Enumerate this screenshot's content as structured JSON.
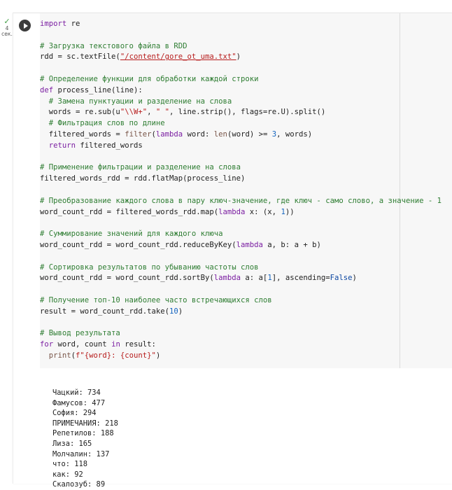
{
  "cell": {
    "status": {
      "check_symbol": "✓",
      "time_value": "4",
      "time_unit": "сек."
    },
    "code_lines": [
      [
        {
          "t": "import",
          "c": "kw"
        },
        {
          "t": " re",
          "c": ""
        }
      ],
      [],
      [
        {
          "t": "# Загрузка текстового файла в RDD",
          "c": "cm"
        }
      ],
      [
        {
          "t": "rdd = sc.textFile(",
          "c": ""
        },
        {
          "t": "\"/content/gore_ot_uma.txt\"",
          "c": "st url"
        },
        {
          "t": ")",
          "c": ""
        }
      ],
      [],
      [
        {
          "t": "# Определение функции для обработки каждой строки",
          "c": "cm"
        }
      ],
      [
        {
          "t": "def",
          "c": "kw"
        },
        {
          "t": " process_line(line):",
          "c": ""
        }
      ],
      [
        {
          "t": "  # Замена пунктуации и разделение на слова",
          "c": "cm"
        }
      ],
      [
        {
          "t": "  words = re.sub(u",
          "c": ""
        },
        {
          "t": "\"\\\\W+\"",
          "c": "st"
        },
        {
          "t": ", ",
          "c": ""
        },
        {
          "t": "\" \"",
          "c": "st"
        },
        {
          "t": ", line.strip(), flags=re.U).split()",
          "c": ""
        }
      ],
      [
        {
          "t": "  # Фильтрация слов по длине",
          "c": "cm"
        }
      ],
      [
        {
          "t": "  filtered_words = ",
          "c": ""
        },
        {
          "t": "filter",
          "c": "bi"
        },
        {
          "t": "(",
          "c": ""
        },
        {
          "t": "lambda",
          "c": "kw"
        },
        {
          "t": " word: ",
          "c": ""
        },
        {
          "t": "len",
          "c": "bi"
        },
        {
          "t": "(word) >= ",
          "c": ""
        },
        {
          "t": "3",
          "c": "nm"
        },
        {
          "t": ", words)",
          "c": ""
        }
      ],
      [
        {
          "t": "  ",
          "c": ""
        },
        {
          "t": "return",
          "c": "kw"
        },
        {
          "t": " filtered_words",
          "c": ""
        }
      ],
      [],
      [
        {
          "t": "# Применение фильтрации и разделение на слова",
          "c": "cm"
        }
      ],
      [
        {
          "t": "filtered_words_rdd = rdd.flatMap(process_line)",
          "c": ""
        }
      ],
      [],
      [
        {
          "t": "# Преобразование каждого слова в пару ключ-значение, где ключ - само слово, а значение - 1",
          "c": "cm"
        }
      ],
      [
        {
          "t": "word_count_rdd = filtered_words_rdd.map(",
          "c": ""
        },
        {
          "t": "lambda",
          "c": "kw"
        },
        {
          "t": " x: (x, ",
          "c": ""
        },
        {
          "t": "1",
          "c": "nm"
        },
        {
          "t": "))",
          "c": ""
        }
      ],
      [],
      [
        {
          "t": "# Суммирование значений для каждого ключа",
          "c": "cm"
        }
      ],
      [
        {
          "t": "word_count_rdd = word_count_rdd.reduceByKey(",
          "c": ""
        },
        {
          "t": "lambda",
          "c": "kw"
        },
        {
          "t": " a, b: a + b)",
          "c": ""
        }
      ],
      [],
      [
        {
          "t": "# Сортировка результатов по убыванию частоты слов",
          "c": "cm"
        }
      ],
      [
        {
          "t": "word_count_rdd = word_count_rdd.sortBy(",
          "c": ""
        },
        {
          "t": "lambda",
          "c": "kw"
        },
        {
          "t": " a: a[",
          "c": ""
        },
        {
          "t": "1",
          "c": "nm"
        },
        {
          "t": "], ascending=",
          "c": ""
        },
        {
          "t": "False",
          "c": "bl"
        },
        {
          "t": ")",
          "c": ""
        }
      ],
      [],
      [
        {
          "t": "# Получение топ-10 наиболее часто встречающихся слов",
          "c": "cm"
        }
      ],
      [
        {
          "t": "result = word_count_rdd.take(",
          "c": ""
        },
        {
          "t": "10",
          "c": "nm"
        },
        {
          "t": ")",
          "c": ""
        }
      ],
      [],
      [
        {
          "t": "# Вывод результата",
          "c": "cm"
        }
      ],
      [
        {
          "t": "for",
          "c": "kw"
        },
        {
          "t": " word, count ",
          "c": ""
        },
        {
          "t": "in",
          "c": "kw"
        },
        {
          "t": " result:",
          "c": ""
        }
      ],
      [
        {
          "t": "  ",
          "c": ""
        },
        {
          "t": "print",
          "c": "bi"
        },
        {
          "t": "(",
          "c": ""
        },
        {
          "t": "f\"{word}: {count}\"",
          "c": "st"
        },
        {
          "t": ")",
          "c": ""
        }
      ]
    ],
    "output_lines": [
      "Чацкий: 734",
      "Фамусов: 477",
      "София: 294",
      "ПРИМЕЧАНИЯ: 218",
      "Репетилов: 188",
      "Лиза: 165",
      "Молчалин: 137",
      "что: 118",
      "как: 92",
      "Скалозуб: 89"
    ]
  }
}
